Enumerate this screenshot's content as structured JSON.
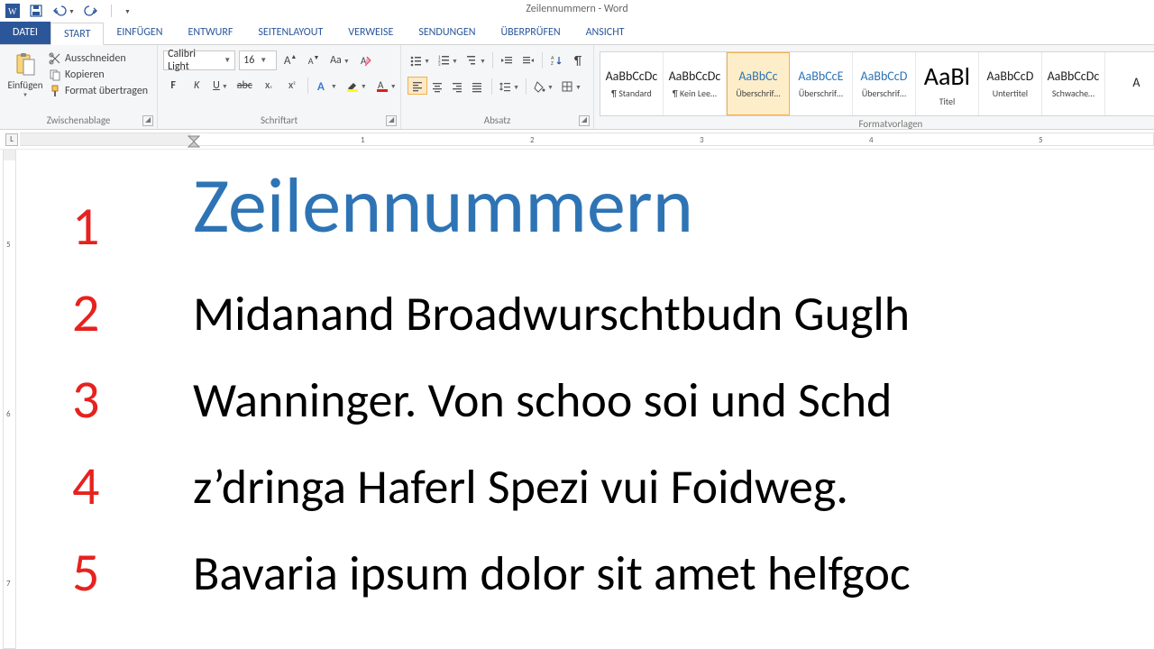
{
  "title": "Zeilennummern - Word",
  "qat": {
    "app": "Word"
  },
  "tabs": {
    "file": "DATEI",
    "items": [
      "START",
      "EINFÜGEN",
      "ENTWURF",
      "SEITENLAYOUT",
      "VERWEISE",
      "SENDUNGEN",
      "ÜBERPRÜFEN",
      "ANSICHT"
    ],
    "active": "START"
  },
  "ribbon": {
    "clipboard": {
      "paste": "Einfügen",
      "cut": "Ausschneiden",
      "copy": "Kopieren",
      "format_painter": "Format übertragen",
      "label": "Zwischenablage"
    },
    "font": {
      "name": "Calibri Light",
      "size": "16",
      "label": "Schriftart"
    },
    "paragraph": {
      "label": "Absatz"
    },
    "styles": {
      "label": "Formatvorlagen",
      "items": [
        {
          "preview": "AaBbCcDc",
          "name": "¶ Standard",
          "cls": ""
        },
        {
          "preview": "AaBbCcDc",
          "name": "¶ Kein Lee…",
          "cls": ""
        },
        {
          "preview": "AaBbCc",
          "name": "Überschrif…",
          "cls": "blue",
          "selected": true
        },
        {
          "preview": "AaBbCcE",
          "name": "Überschrif…",
          "cls": "blue"
        },
        {
          "preview": "AaBbCcD",
          "name": "Überschrif…",
          "cls": "blue"
        },
        {
          "preview": "AaBl",
          "name": "Titel",
          "cls": "big"
        },
        {
          "preview": "AaBbCcD",
          "name": "Untertitel",
          "cls": ""
        },
        {
          "preview": "AaBbCcDc",
          "name": "Schwache…",
          "cls": ""
        },
        {
          "preview": "A",
          "name": "",
          "cls": ""
        }
      ]
    }
  },
  "ruler": {
    "marks": [
      "1",
      "2",
      "3",
      "4",
      "5"
    ]
  },
  "document": {
    "line_numbers": [
      "1",
      "2",
      "3",
      "4",
      "5"
    ],
    "heading": "Zeilennummern",
    "body_lines": [
      "Midanand Broadwurschtbudn Guglh",
      "Wanninger. Von schoo soi und Schd",
      "z’dringa Haferl Spezi vui Foidweg.",
      "Bavaria ipsum dolor sit amet helfgoc"
    ]
  },
  "colors": {
    "accent": "#2b579a",
    "heading": "#2e74b5",
    "line_number": "#e6221f"
  }
}
